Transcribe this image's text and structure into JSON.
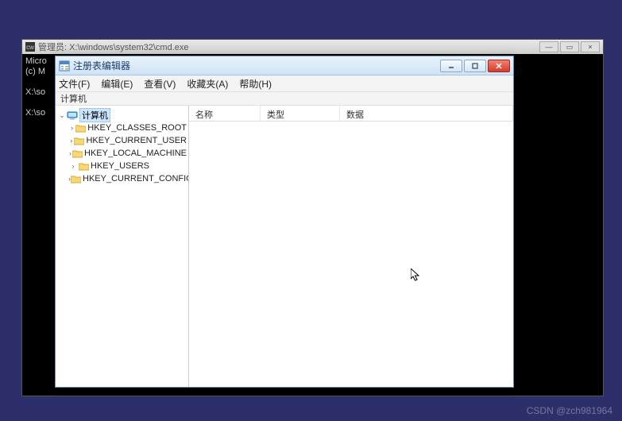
{
  "cmd": {
    "title": "管理员: X:\\windows\\system32\\cmd.exe",
    "icon_label": "cw",
    "lines": [
      "Micro",
      "(c) M",
      "",
      "X:\\so",
      "",
      "X:\\so"
    ],
    "min": "—",
    "max": "▭",
    "close": "×"
  },
  "reg": {
    "title": "注册表编辑器",
    "menu": {
      "file": "文件(F)",
      "edit": "编辑(E)",
      "view": "查看(V)",
      "favorites": "收藏夹(A)",
      "help": "帮助(H)"
    },
    "address": "计算机",
    "tree": {
      "root": "计算机",
      "hives": [
        "HKEY_CLASSES_ROOT",
        "HKEY_CURRENT_USER",
        "HKEY_LOCAL_MACHINE",
        "HKEY_USERS",
        "HKEY_CURRENT_CONFIG"
      ]
    },
    "columns": {
      "name": "名称",
      "type": "类型",
      "data": "数据"
    }
  },
  "watermark": "CSDN @zch981964"
}
